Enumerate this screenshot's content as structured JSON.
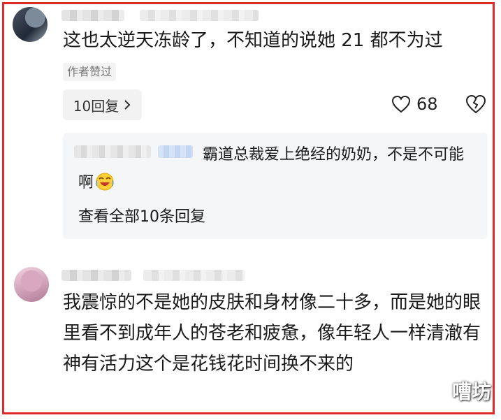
{
  "comment1": {
    "text": "这也太逆天冻龄了，不知道的说她 21 都不为过",
    "author_liked_badge": "作者赞过",
    "reply_button_label": "10回复",
    "like_count": "68",
    "reply_preview": {
      "text": "霸道总裁爱上绝经的奶奶，不是不可能啊",
      "emoji": "crying-laughing-face-icon"
    },
    "view_all_label": "查看全部10条回复"
  },
  "comment2": {
    "text": "我震惊的不是她的皮肤和身材像二十多，而是她的眼里看不到成年人的苍老和疲惫，像年轻人一样清澈有神有活力这个是花钱花时间换不来的"
  },
  "watermark": "嘈坊",
  "colors": {
    "border": "#e02a2a",
    "reply_bg": "#f5f6f7"
  }
}
